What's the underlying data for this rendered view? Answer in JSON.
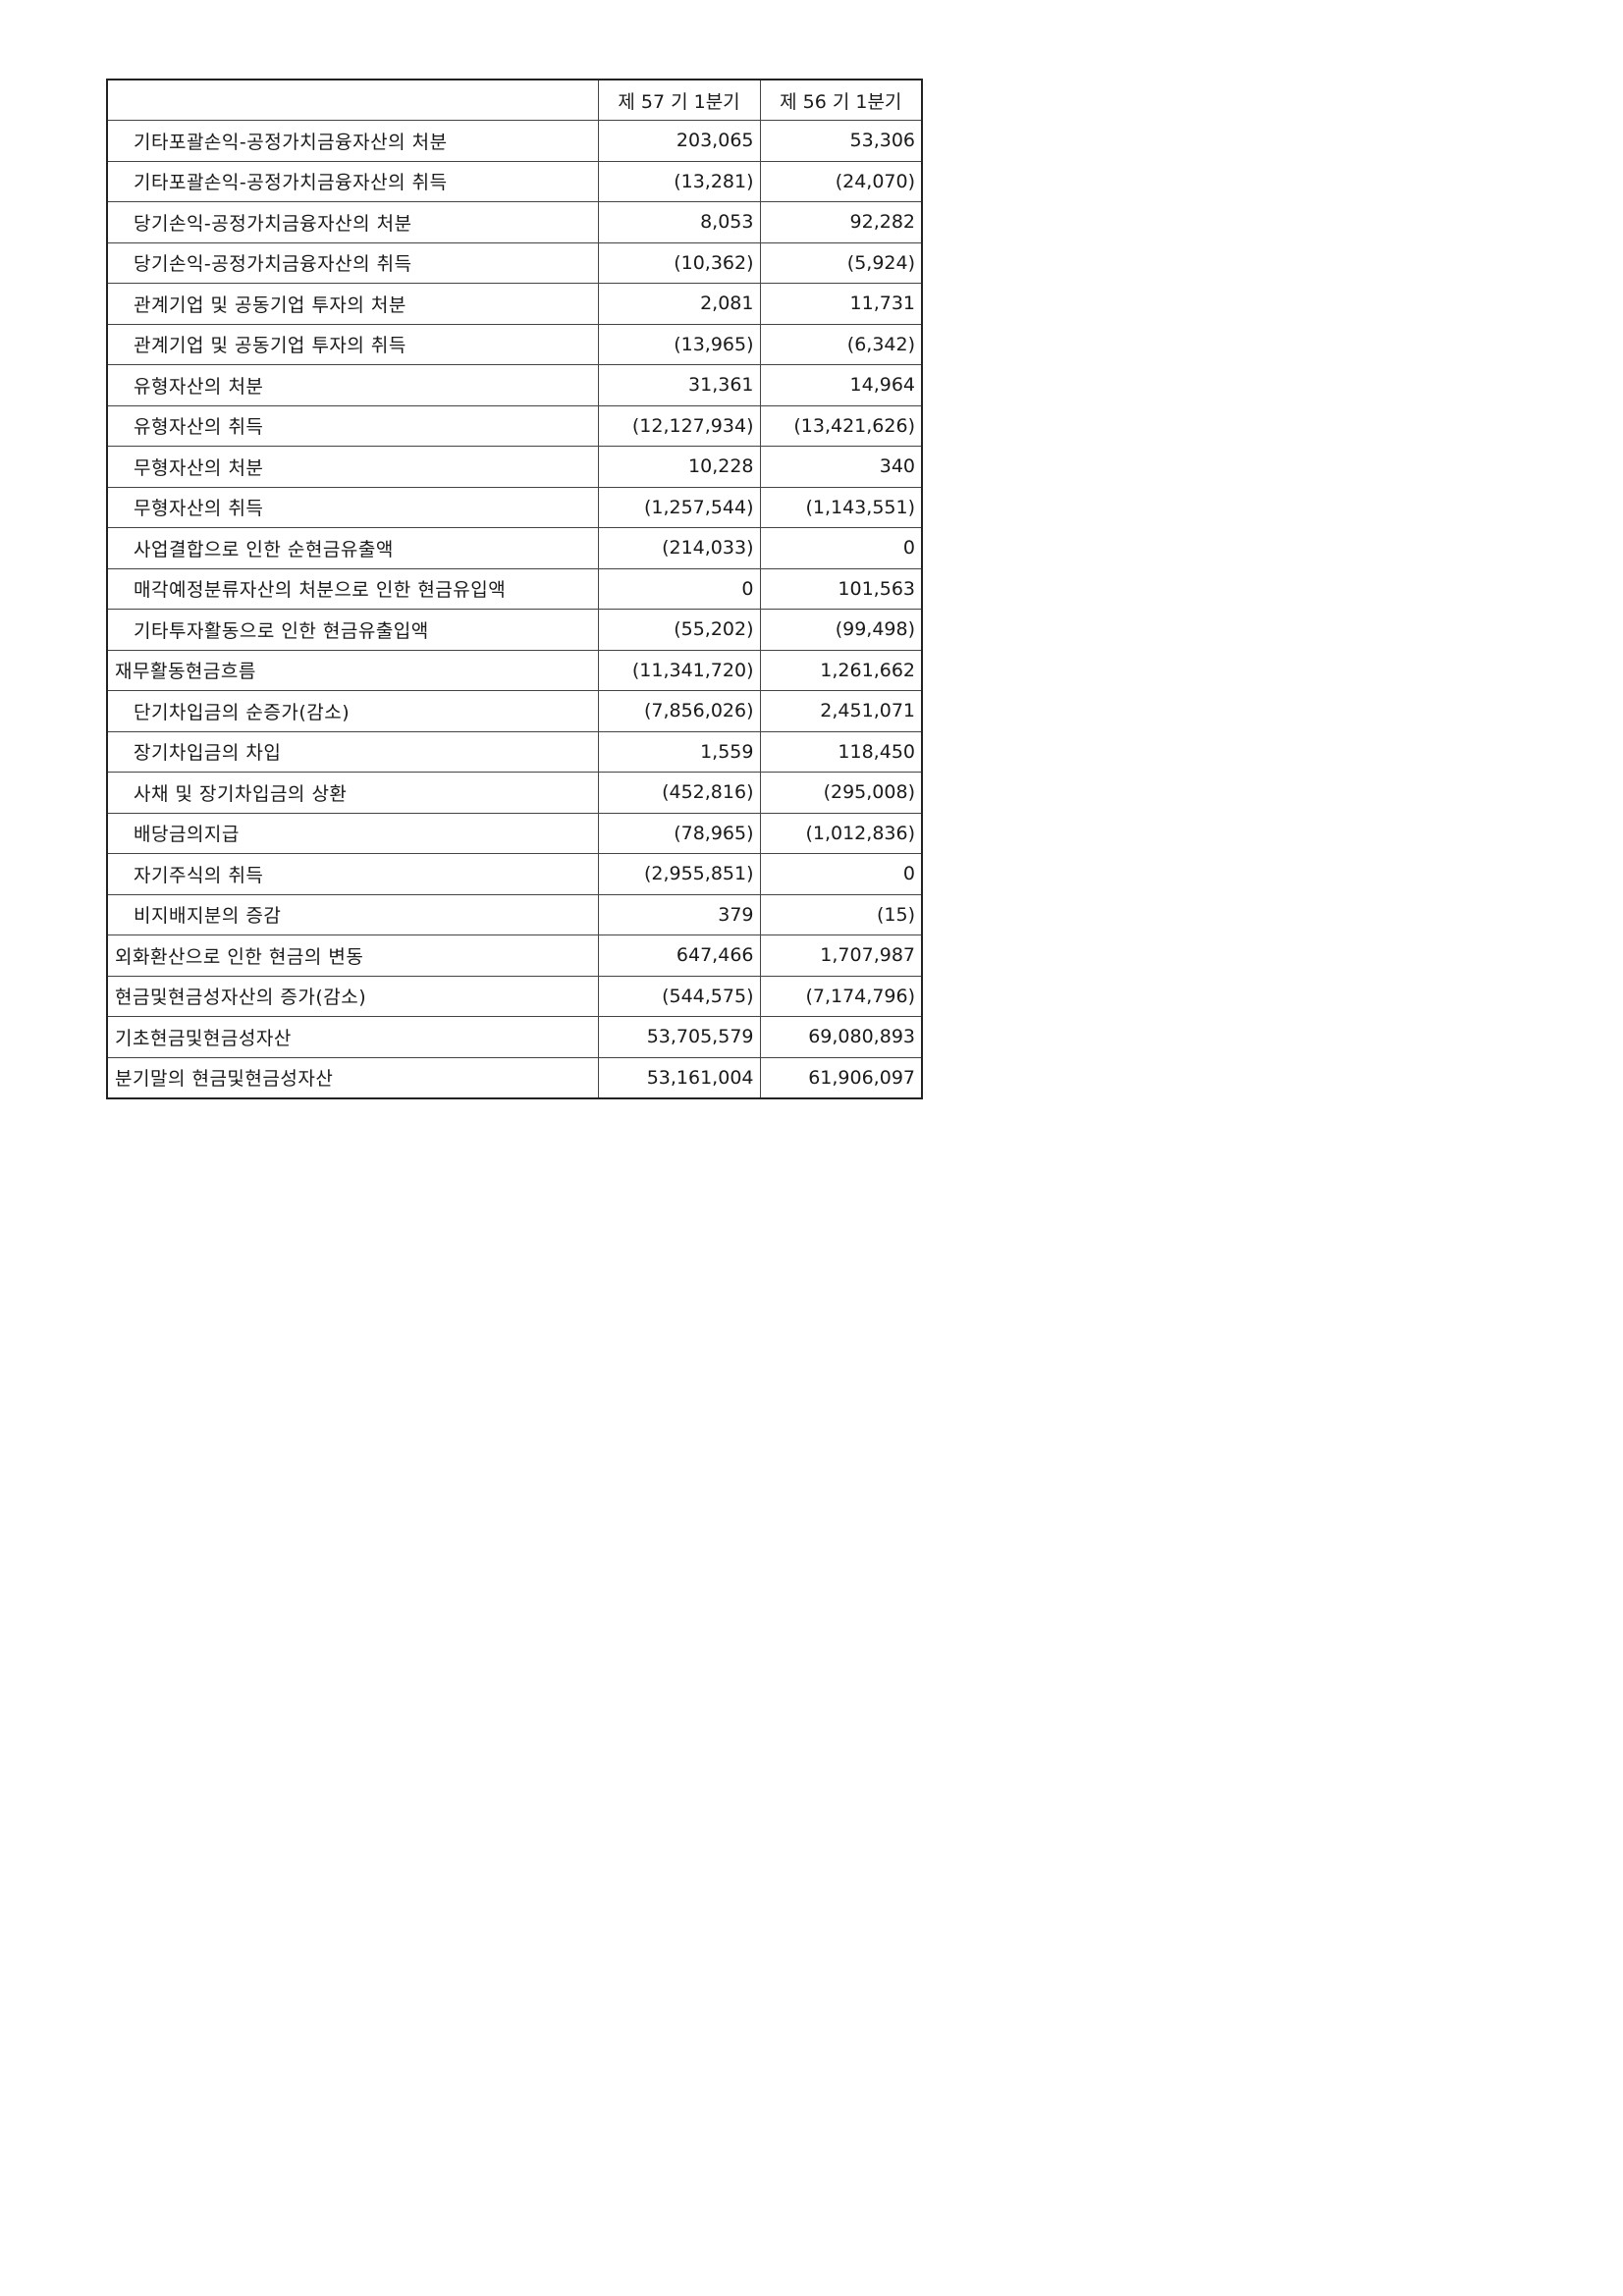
{
  "table": {
    "header": {
      "blank": "",
      "col1": "제 57 기 1분기",
      "col2": "제 56 기 1분기"
    },
    "rows": [
      {
        "label": "기타포괄손익-공정가치금융자산의 처분",
        "v1": "203,065",
        "v2": "53,306",
        "indent": true
      },
      {
        "label": "기타포괄손익-공정가치금융자산의 취득",
        "v1": "(13,281)",
        "v2": "(24,070)",
        "indent": true
      },
      {
        "label": "당기손익-공정가치금융자산의 처분",
        "v1": "8,053",
        "v2": "92,282",
        "indent": true
      },
      {
        "label": "당기손익-공정가치금융자산의 취득",
        "v1": "(10,362)",
        "v2": "(5,924)",
        "indent": true
      },
      {
        "label": "관계기업 및 공동기업 투자의 처분",
        "v1": "2,081",
        "v2": "11,731",
        "indent": true
      },
      {
        "label": "관계기업 및 공동기업 투자의 취득",
        "v1": "(13,965)",
        "v2": "(6,342)",
        "indent": true
      },
      {
        "label": "유형자산의 처분",
        "v1": "31,361",
        "v2": "14,964",
        "indent": true
      },
      {
        "label": "유형자산의 취득",
        "v1": "(12,127,934)",
        "v2": "(13,421,626)",
        "indent": true
      },
      {
        "label": "무형자산의 처분",
        "v1": "10,228",
        "v2": "340",
        "indent": true
      },
      {
        "label": "무형자산의 취득",
        "v1": "(1,257,544)",
        "v2": "(1,143,551)",
        "indent": true
      },
      {
        "label": "사업결합으로 인한 순현금유출액",
        "v1": "(214,033)",
        "v2": "0",
        "indent": true
      },
      {
        "label": "매각예정분류자산의 처분으로 인한 현금유입액",
        "v1": "0",
        "v2": "101,563",
        "indent": true
      },
      {
        "label": "기타투자활동으로 인한 현금유출입액",
        "v1": "(55,202)",
        "v2": "(99,498)",
        "indent": true
      },
      {
        "label": "재무활동현금흐름",
        "v1": "(11,341,720)",
        "v2": "1,261,662",
        "indent": false
      },
      {
        "label": "단기차입금의 순증가(감소)",
        "v1": "(7,856,026)",
        "v2": "2,451,071",
        "indent": true
      },
      {
        "label": "장기차입금의 차입",
        "v1": "1,559",
        "v2": "118,450",
        "indent": true
      },
      {
        "label": "사채 및 장기차입금의 상환",
        "v1": "(452,816)",
        "v2": "(295,008)",
        "indent": true
      },
      {
        "label": "배당금의지급",
        "v1": "(78,965)",
        "v2": "(1,012,836)",
        "indent": true
      },
      {
        "label": "자기주식의 취득",
        "v1": "(2,955,851)",
        "v2": "0",
        "indent": true
      },
      {
        "label": "비지배지분의 증감",
        "v1": "379",
        "v2": "(15)",
        "indent": true
      },
      {
        "label": "외화환산으로 인한 현금의 변동",
        "v1": "647,466",
        "v2": "1,707,987",
        "indent": false
      },
      {
        "label": "현금및현금성자산의 증가(감소)",
        "v1": "(544,575)",
        "v2": "(7,174,796)",
        "indent": false
      },
      {
        "label": "기초현금및현금성자산",
        "v1": "53,705,579",
        "v2": "69,080,893",
        "indent": false
      },
      {
        "label": "분기말의 현금및현금성자산",
        "v1": "53,161,004",
        "v2": "61,906,097",
        "indent": false
      }
    ]
  }
}
